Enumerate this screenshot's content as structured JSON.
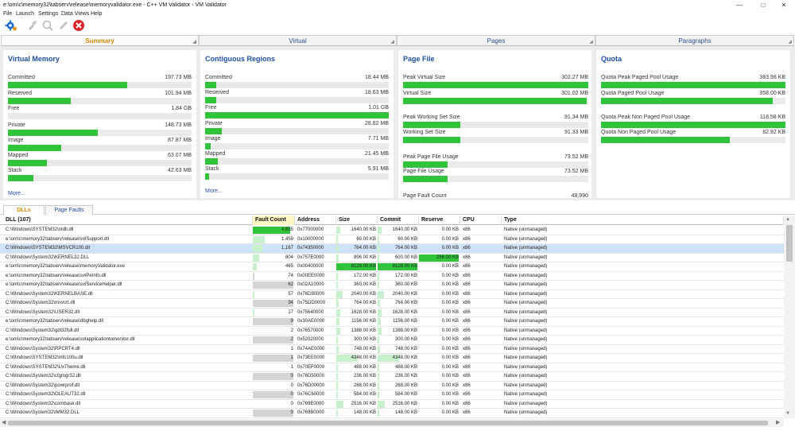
{
  "window": {
    "title": "e:\\om\\c\\memory32\\tabserv\\release\\memoryvalidator.exe - C++ VM Validator - VM Validator",
    "min": "—",
    "max": "□",
    "close": "✕"
  },
  "menu": [
    "File",
    "Launch",
    "Settings",
    "Data Views",
    "Help"
  ],
  "toolbar": {
    "icons": [
      "settings-gear",
      "pin",
      "pin-search",
      "pencil",
      "stop"
    ]
  },
  "top_tabs": [
    {
      "label": "Summary",
      "active": true
    },
    {
      "label": "Virtual",
      "active": false
    },
    {
      "label": "Pages",
      "active": false
    },
    {
      "label": "Paragraphs",
      "active": false
    }
  ],
  "panels": {
    "virtual_memory": {
      "title": "Virtual Memory",
      "rows": [
        {
          "label": "Committed",
          "value": "197.73 MB",
          "fraction": 0.65
        },
        {
          "label": "Reserved",
          "value": "101.94 MB",
          "fraction": 0.34
        },
        {
          "label": "Free",
          "value": "1.84 GB",
          "fraction": null
        },
        {
          "label": "Private",
          "value": "148.73 MB",
          "fraction": 0.49
        },
        {
          "label": "Image",
          "value": "87.87 MB",
          "fraction": 0.29
        },
        {
          "label": "Mapped",
          "value": "63.07 MB",
          "fraction": 0.21
        },
        {
          "label": "Stack",
          "value": "42.63 MB",
          "fraction": 0.14
        }
      ],
      "more": "More..."
    },
    "contiguous_regions": {
      "title": "Contiguous Regions",
      "rows": [
        {
          "label": "Committed",
          "value": "18.44 MB",
          "fraction": 0.06
        },
        {
          "label": "Reserved",
          "value": "18.63 MB",
          "fraction": 0.06
        },
        {
          "label": "Free",
          "value": "1.01 GB",
          "fraction": 1.0
        },
        {
          "label": "Private",
          "value": "28.82 MB",
          "fraction": 0.09
        },
        {
          "label": "Image",
          "value": "7.71 MB",
          "fraction": 0.03
        },
        {
          "label": "Mapped",
          "value": "21.45 MB",
          "fraction": 0.07
        },
        {
          "label": "Stack",
          "value": "5.91 MB",
          "fraction": 0.02
        }
      ],
      "more": "More..."
    },
    "page_file": {
      "title": "Page File",
      "rows": [
        {
          "label": "Peak Virtual Size",
          "value": "302.27 MB",
          "fraction": 1.0
        },
        {
          "label": "Virtual Size",
          "value": "301.02 MB",
          "fraction": 0.99
        },
        {
          "label": "Peak Working Set Size",
          "value": "91.34 MB",
          "fraction": 0.31
        },
        {
          "label": "Working Set Size",
          "value": "91.33 MB",
          "fraction": 0.31
        },
        {
          "label": "Peak Page File Usage",
          "value": "73.52 MB",
          "fraction": 0.24
        },
        {
          "label": "Page File Usage",
          "value": "73.52 MB",
          "fraction": 0.24
        }
      ],
      "fault_count": {
        "label": "Page Fault Count",
        "value": "48,990"
      }
    },
    "quota": {
      "title": "Quota",
      "rows": [
        {
          "label": "Quota Peak Paged Pool Usage",
          "value": "383.98 KB",
          "fraction": 1.0
        },
        {
          "label": "Quota Paged Pool Usage",
          "value": "358.00 KB",
          "fraction": 0.93
        },
        {
          "label": "Quota Peak Non Paged Pool Usage",
          "value": "118.58 KB",
          "fraction": 1.0
        },
        {
          "label": "Quota Non Paged Pool Usage",
          "value": "82.92 KB",
          "fraction": 0.7
        }
      ]
    }
  },
  "sub_tabs": [
    {
      "label": "DLLs",
      "active": true
    },
    {
      "label": "Page Faults",
      "active": false
    }
  ],
  "grid": {
    "columns": [
      "DLL (107)",
      "Fault Count",
      "Address",
      "Size",
      "Commit",
      "Reserve",
      "CPU",
      "Type"
    ],
    "rows": [
      {
        "dll": "C:\\Windows\\SYSTEM32\\ntdll.dll",
        "faults": "4,655",
        "fault_frac": 0.93,
        "fault_style": "g",
        "address": "0x77000000",
        "size": "1640.00 KB",
        "size_frac": 0.1,
        "commit": "1640.00 KB",
        "commit_frac": 0.1,
        "reserve": "0.00 KB",
        "reserve_frac": 0,
        "cpu": "x86",
        "type": "Native (unmanaged)"
      },
      {
        "dll": "e:\\om\\c\\memory32\\tabserv\\release\\svlSupport.dll",
        "faults": "1,459",
        "fault_frac": 0.29,
        "fault_style": "lg",
        "address": "0x10000000",
        "size": "60.00 KB",
        "size_frac": 0.01,
        "commit": "60.00 KB",
        "commit_frac": 0.01,
        "reserve": "0.00 KB",
        "reserve_frac": 0,
        "cpu": "x86",
        "type": "Native (unmanaged)"
      },
      {
        "dll": "C:\\Windows\\SYSTEM32\\MSVCR100.dll",
        "faults": "1,167",
        "fault_frac": 0.23,
        "fault_style": "lg",
        "address": "0x74350000",
        "size": "764.00 KB",
        "size_frac": 0.05,
        "commit": "764.00 KB",
        "commit_frac": 0.05,
        "reserve": "0.00 KB",
        "reserve_frac": 0,
        "cpu": "x86",
        "type": "Native (unmanaged)",
        "selected": true
      },
      {
        "dll": "C:\\Windows\\System32\\KERNEL32.DLL",
        "faults": "804",
        "fault_frac": 0.16,
        "fault_style": "lg",
        "address": "0x757E0000",
        "size": "896.00 KB",
        "size_frac": 0.06,
        "commit": "600.00 KB",
        "commit_frac": 0.04,
        "reserve": "296.00 KB",
        "reserve_frac": 1.0,
        "cpu": "x86",
        "type": "Native (unmanaged)"
      },
      {
        "dll": "e:\\om\\c\\memory32\\tabserv\\release\\memoryValidator.exe",
        "faults": "465",
        "fault_frac": 0.09,
        "fault_style": "lg",
        "address": "0x00400000",
        "size": "8128.00 KB",
        "size_frac": 1.0,
        "commit": "8128.00 KB",
        "commit_frac": 1.0,
        "reserve": "0.00 KB",
        "reserve_frac": 0,
        "cpu": "x86",
        "type": "Native (unmanaged)"
      },
      {
        "dll": "e:\\om\\c\\memory32\\tabserv\\release\\svlPeInfo.dll",
        "faults": "74",
        "fault_frac": 0.03,
        "fault_style": "gray",
        "address": "0x00EE0000",
        "size": "172.00 KB",
        "size_frac": 0.02,
        "commit": "172.00 KB",
        "commit_frac": 0.02,
        "reserve": "0.00 KB",
        "reserve_frac": 0,
        "cpu": "x86",
        "type": "Native (unmanaged)"
      },
      {
        "dll": "e:\\om\\c\\memory32\\tabserv\\release\\svlServiceHelper.dll",
        "faults": "62",
        "fault_frac": 1.0,
        "fault_style": "gray",
        "address": "0x02A10000",
        "size": "360.00 KB",
        "size_frac": 0.03,
        "commit": "360.00 KB",
        "commit_frac": 0.03,
        "reserve": "0.00 KB",
        "reserve_frac": 0,
        "cpu": "x86",
        "type": "Native (unmanaged)"
      },
      {
        "dll": "C:\\Windows\\System32\\KERNELBASE.dll",
        "faults": "57",
        "fault_frac": 0.01,
        "fault_style": "lg",
        "address": "0x76D90000",
        "size": "2040.00 KB",
        "size_frac": 0.15,
        "commit": "2040.00 KB",
        "commit_frac": 0.15,
        "reserve": "0.00 KB",
        "reserve_frac": 0,
        "cpu": "x86",
        "type": "Native (unmanaged)"
      },
      {
        "dll": "C:\\Windows\\System32\\msvcrt.dll",
        "faults": "34",
        "fault_frac": 1.0,
        "fault_style": "gray",
        "address": "0x75DD0000",
        "size": "764.00 KB",
        "size_frac": 0.05,
        "commit": "764.00 KB",
        "commit_frac": 0.05,
        "reserve": "0.00 KB",
        "reserve_frac": 0,
        "cpu": "x86",
        "type": "Native (unmanaged)"
      },
      {
        "dll": "C:\\Windows\\System32\\USER32.dll",
        "faults": "17",
        "fault_frac": 0.01,
        "fault_style": "lg",
        "address": "0x75640000",
        "size": "1628.00 KB",
        "size_frac": 0.1,
        "commit": "1628.00 KB",
        "commit_frac": 0.1,
        "reserve": "0.00 KB",
        "reserve_frac": 0,
        "cpu": "x86",
        "type": "Native (unmanaged)"
      },
      {
        "dll": "e:\\om\\c\\memory32\\tabserv\\release\\dbghelp.dll",
        "faults": "9",
        "fault_frac": 1.0,
        "fault_style": "gray",
        "address": "0x30AE0000",
        "size": "1156.00 KB",
        "size_frac": 0.08,
        "commit": "1156.00 KB",
        "commit_frac": 0.08,
        "reserve": "0.00 KB",
        "reserve_frac": 0,
        "cpu": "x86",
        "type": "Native (unmanaged)"
      },
      {
        "dll": "C:\\Windows\\System32\\gdi32full.dll",
        "faults": "2",
        "fault_frac": 0.0,
        "fault_style": "lg",
        "address": "0x76570000",
        "size": "1388.00 KB",
        "size_frac": 0.09,
        "commit": "1388.00 KB",
        "commit_frac": 0.09,
        "reserve": "0.00 KB",
        "reserve_frac": 0,
        "cpu": "x86",
        "type": "Native (unmanaged)"
      },
      {
        "dll": "e:\\om\\c\\memory32\\tabserv\\release\\svlapplicationtomonitor.dll",
        "faults": "2",
        "fault_frac": 1.0,
        "fault_style": "gray",
        "address": "0x52020000",
        "size": "300.00 KB",
        "size_frac": 0.02,
        "commit": "300.00 KB",
        "commit_frac": 0.02,
        "reserve": "0.00 KB",
        "reserve_frac": 0,
        "cpu": "x86",
        "type": "Native (unmanaged)"
      },
      {
        "dll": "C:\\Windows\\System32\\RPCRT4.dll",
        "faults": "1",
        "fault_frac": 0.0,
        "fault_style": "lg",
        "address": "0x74AE0000",
        "size": "748.00 KB",
        "size_frac": 0.05,
        "commit": "748.00 KB",
        "commit_frac": 0.05,
        "reserve": "0.00 KB",
        "reserve_frac": 0,
        "cpu": "x86",
        "type": "Native (unmanaged)"
      },
      {
        "dll": "C:\\Windows\\SYSTEM32\\mfc100u.dll",
        "faults": "1",
        "fault_frac": 1.0,
        "fault_style": "gray",
        "address": "0x73EE0000",
        "size": "4348.00 KB",
        "size_frac": 0.53,
        "commit": "4348.00 KB",
        "commit_frac": 0.53,
        "reserve": "0.00 KB",
        "reserve_frac": 0,
        "cpu": "x86",
        "type": "Native (unmanaged)"
      },
      {
        "dll": "C:\\Windows\\SYSTEM32\\UxTheme.dll",
        "faults": "1",
        "fault_frac": 0.0,
        "fault_style": "lg",
        "address": "0x70EF0000",
        "size": "488.00 KB",
        "size_frac": 0.03,
        "commit": "488.00 KB",
        "commit_frac": 0.03,
        "reserve": "0.00 KB",
        "reserve_frac": 0,
        "cpu": "x86",
        "type": "Native (unmanaged)"
      },
      {
        "dll": "C:\\Windows\\System32\\cfgmgr32.dll",
        "faults": "0",
        "fault_frac": 1.0,
        "fault_style": "gray",
        "address": "0x76D50000",
        "size": "236.00 KB",
        "size_frac": 0.02,
        "commit": "236.00 KB",
        "commit_frac": 0.02,
        "reserve": "0.00 KB",
        "reserve_frac": 0,
        "cpu": "x86",
        "type": "Native (unmanaged)"
      },
      {
        "dll": "C:\\Windows\\System32\\powrprof.dll",
        "faults": "0",
        "fault_frac": 0.0,
        "fault_style": "lg",
        "address": "0x76D00000",
        "size": "268.00 KB",
        "size_frac": 0.02,
        "commit": "268.00 KB",
        "commit_frac": 0.02,
        "reserve": "0.00 KB",
        "reserve_frac": 0,
        "cpu": "x86",
        "type": "Native (unmanaged)"
      },
      {
        "dll": "C:\\Windows\\System32\\OLEAUT32.dll",
        "faults": "0",
        "fault_frac": 1.0,
        "fault_style": "gray",
        "address": "0x76C60000",
        "size": "584.00 KB",
        "size_frac": 0.04,
        "commit": "584.00 KB",
        "commit_frac": 0.04,
        "reserve": "0.00 KB",
        "reserve_frac": 0,
        "cpu": "x86",
        "type": "Native (unmanaged)"
      },
      {
        "dll": "C:\\Windows\\System32\\combase.dll",
        "faults": "0",
        "fault_frac": 0.0,
        "fault_style": "lg",
        "address": "0x769E0000",
        "size": "2516.00 KB",
        "size_frac": 0.17,
        "commit": "2516.00 KB",
        "commit_frac": 0.17,
        "reserve": "0.00 KB",
        "reserve_frac": 0,
        "cpu": "x86",
        "type": "Native (unmanaged)"
      },
      {
        "dll": "C:\\Windows\\System32\\IMM32.DLL",
        "faults": "0",
        "fault_frac": 1.0,
        "fault_style": "gray",
        "address": "0x769B0000",
        "size": "148.00 KB",
        "size_frac": 0.01,
        "commit": "148.00 KB",
        "commit_frac": 0.01,
        "reserve": "0.00 KB",
        "reserve_frac": 0,
        "cpu": "x86",
        "type": "Native (unmanaged)"
      }
    ]
  },
  "colors": {
    "accent": "#1f4fa0",
    "active_tab": "#d08a00",
    "bar": "#2fc43a",
    "bar_light": "#c8f0cc",
    "selection": "#cfe3f7"
  }
}
